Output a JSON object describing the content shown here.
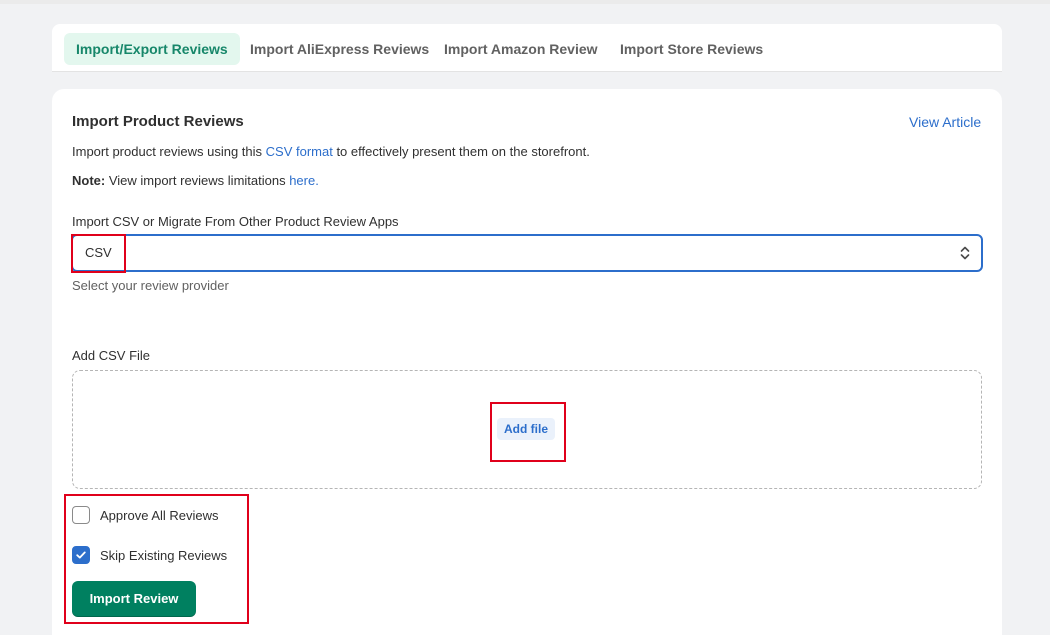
{
  "tabs": [
    {
      "label": "Import/Export Reviews",
      "active": true
    },
    {
      "label": "Import AliExpress Reviews",
      "active": false
    },
    {
      "label": "Import Amazon Review",
      "active": false
    },
    {
      "label": "Import Store Reviews",
      "active": false
    }
  ],
  "card": {
    "title": "Import Product Reviews",
    "view_article": "View Article",
    "description": {
      "before": "Import product reviews using this ",
      "link": "CSV format",
      "after": " to effectively present them on the storefront."
    },
    "note": {
      "label": "Note:",
      "text": " View import reviews limitations ",
      "link": "here."
    }
  },
  "provider_select": {
    "label": "Import CSV or Migrate From Other Product Review Apps",
    "value": "CSV",
    "help_text": "Select your review provider"
  },
  "file_upload": {
    "label": "Add CSV File",
    "button_label": "Add file"
  },
  "options": {
    "approve_all": {
      "label": "Approve All Reviews",
      "checked": false
    },
    "skip_existing": {
      "label": "Skip Existing Reviews",
      "checked": true
    }
  },
  "import_button": "Import Review",
  "colors": {
    "accent_blue": "#2c6ecb",
    "primary_green": "#008060",
    "active_tab_bg": "#e3f7ee",
    "active_tab_text": "#17876a",
    "highlight_red": "#e0001b"
  },
  "icons": {
    "select_chevron": "select-chevron-icon",
    "checkmark": "checkmark-icon"
  }
}
